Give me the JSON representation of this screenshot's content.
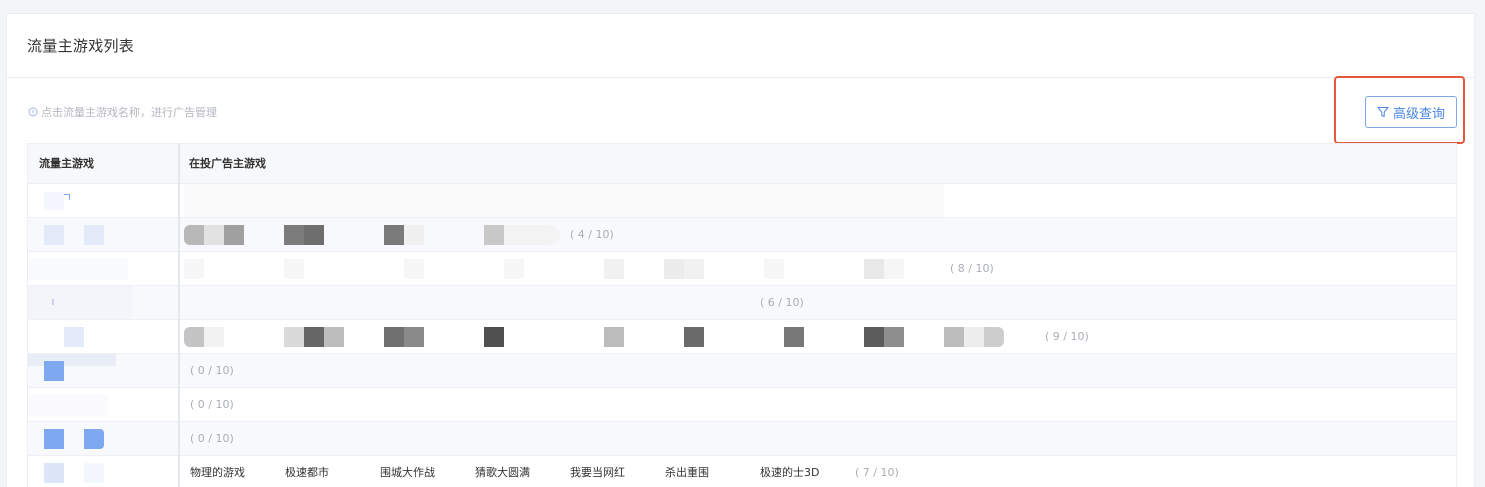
{
  "page": {
    "title": "流量主游戏列表",
    "hint": "点击流量主游戏名称，进行广告管理",
    "query_button": "高级查询"
  },
  "table": {
    "columns": [
      "流量主游戏",
      "在投广告主游戏"
    ],
    "rows": [
      {
        "count": "",
        "games": []
      },
      {
        "count": "( 4 / 10)",
        "games": []
      },
      {
        "count": "( 8 / 10)",
        "games": []
      },
      {
        "count": "( 6 / 10)",
        "games": []
      },
      {
        "count": "( 9 / 10)",
        "games": []
      },
      {
        "count": "( 0 / 10)",
        "games": []
      },
      {
        "count": "( 0 / 10)",
        "games": []
      },
      {
        "count": "( 0 / 10)",
        "games": []
      },
      {
        "count": "( 7 / 10)",
        "games": [
          "物理的游戏",
          "极速都市",
          "围城大作战",
          "猜歌大圆满",
          "我要当网红",
          "杀出重围",
          "极速的士3D"
        ]
      }
    ]
  },
  "colors": {
    "accent": "#4a86e0",
    "highlight_border": "#e2593b",
    "blur_blue": "#7ea8f0",
    "blur_gray_dark": "#5e5e5e"
  }
}
